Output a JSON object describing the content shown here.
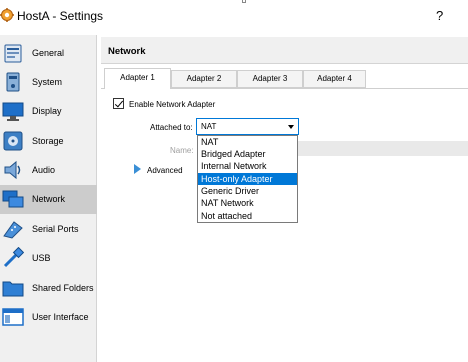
{
  "window": {
    "title": "HostA - Settings",
    "help_label": "?"
  },
  "sidebar": {
    "items": [
      {
        "label": "General",
        "icon": "general-icon"
      },
      {
        "label": "System",
        "icon": "system-icon"
      },
      {
        "label": "Display",
        "icon": "display-icon"
      },
      {
        "label": "Storage",
        "icon": "storage-icon"
      },
      {
        "label": "Audio",
        "icon": "audio-icon"
      },
      {
        "label": "Network",
        "icon": "network-icon",
        "active": true
      },
      {
        "label": "Serial Ports",
        "icon": "serial-ports-icon"
      },
      {
        "label": "USB",
        "icon": "usb-icon"
      },
      {
        "label": "Shared Folders",
        "icon": "shared-folders-icon"
      },
      {
        "label": "User Interface",
        "icon": "user-interface-icon"
      }
    ]
  },
  "page": {
    "title": "Network"
  },
  "tabs": [
    {
      "label": "Adapter 1",
      "active": true
    },
    {
      "label": "Adapter 2"
    },
    {
      "label": "Adapter 3"
    },
    {
      "label": "Adapter 4"
    }
  ],
  "adapter": {
    "enable_label": "Enable Network Adapter",
    "enabled": true,
    "attached_label": "Attached to:",
    "attached_value": "NAT",
    "name_label": "Name:",
    "advanced_label": "Advanced"
  },
  "dropdown": {
    "options": [
      "NAT",
      "Bridged Adapter",
      "Internal Network",
      "Host-only Adapter",
      "Generic Driver",
      "NAT Network",
      "Not attached"
    ],
    "highlighted": "Host-only Adapter"
  },
  "colors": {
    "accent": "#0078d7",
    "selected_sidebar": "#cccccc"
  }
}
